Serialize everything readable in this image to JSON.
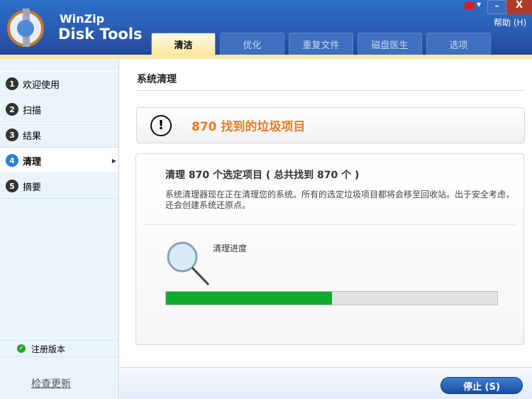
{
  "app": {
    "brand_line1": "WinZip",
    "brand_line2": "Disk Tools",
    "help": "帮助 (H)",
    "minimize": "–",
    "close": "X"
  },
  "tabs": [
    {
      "label": "清洁"
    },
    {
      "label": "优化"
    },
    {
      "label": "重复文件"
    },
    {
      "label": "磁盘医生"
    },
    {
      "label": "选项"
    }
  ],
  "sidebar": {
    "items": [
      {
        "num": "1",
        "label": "欢迎使用"
      },
      {
        "num": "2",
        "label": "扫描"
      },
      {
        "num": "3",
        "label": "结果"
      },
      {
        "num": "4",
        "label": "清理"
      },
      {
        "num": "5",
        "label": "摘要"
      }
    ],
    "registered": "注册版本",
    "check_update": "检查更新"
  },
  "main": {
    "title": "系统清理",
    "alert": "870 找到的垃圾项目",
    "panel_title": "清理 870 个选定项目 ( 总共找到 870 个 )",
    "panel_desc": "系统清理器现在正在清理您的系统。所有的选定垃圾项目都将会移至回收站。出于安全考虑，还会创建系统还原点。",
    "progress_label": "清理进度",
    "progress_percent": 50
  },
  "footer": {
    "stop": "停止 (S)"
  }
}
